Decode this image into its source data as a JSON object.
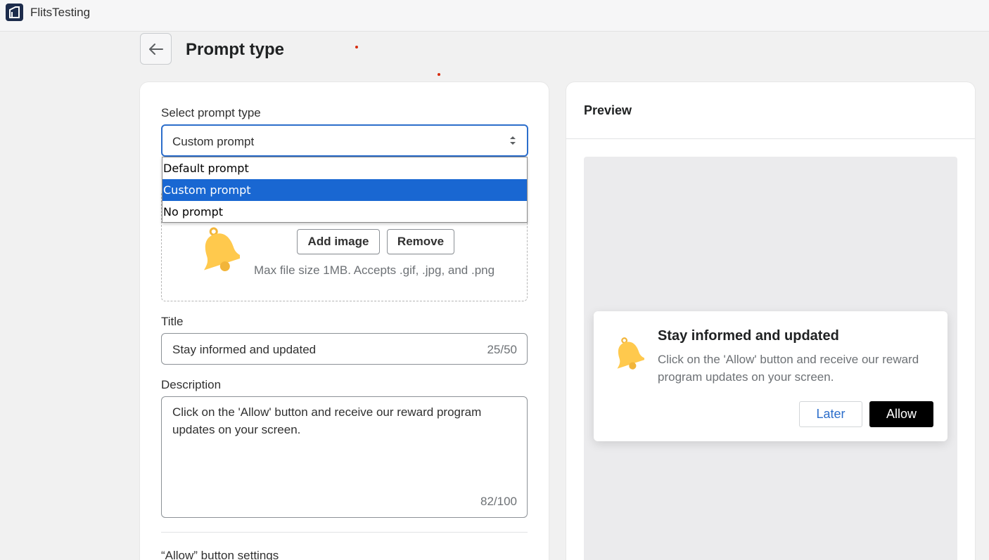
{
  "app": {
    "name": "FlitsTesting"
  },
  "page": {
    "title": "Prompt type"
  },
  "form": {
    "select_label": "Select prompt type",
    "select_value": "Custom prompt",
    "options": [
      "Default prompt",
      "Custom prompt",
      "No prompt"
    ],
    "selected_option": "Custom prompt",
    "image": {
      "add_label": "Add image",
      "remove_label": "Remove",
      "hint": "Max file size 1MB. Accepts .gif, .jpg, and .png"
    },
    "title_label": "Title",
    "title_value": "Stay informed and updated",
    "title_counter": "25/50",
    "description_label": "Description",
    "description_value": "Click on the 'Allow' button and receive our reward program updates on your screen.",
    "description_counter": "82/100",
    "allow_section_label": "“Allow” button settings"
  },
  "preview": {
    "heading": "Preview",
    "prompt_title": "Stay informed and updated",
    "prompt_description": "Click on the 'Allow' button and receive our reward program updates on your screen.",
    "later_label": "Later",
    "allow_label": "Allow"
  },
  "colors": {
    "accent": "#2c6ecb",
    "option_highlight": "#1967d2",
    "bell": "#ffc94d",
    "allow_button": "#000000"
  },
  "icons": {
    "logo": "home-logo-icon",
    "back": "arrow-left-icon",
    "select": "select-arrows-icon",
    "bell": "bell-icon"
  }
}
